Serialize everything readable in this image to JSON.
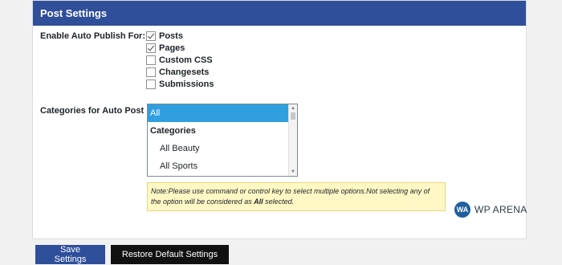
{
  "panel": {
    "title": "Post Settings"
  },
  "auto_publish": {
    "label": "Enable Auto Publish For:",
    "options": [
      {
        "label": "Posts",
        "checked": true
      },
      {
        "label": "Pages",
        "checked": true
      },
      {
        "label": "Custom CSS",
        "checked": false
      },
      {
        "label": "Changesets",
        "checked": false
      },
      {
        "label": "Submissions",
        "checked": false
      }
    ]
  },
  "categories": {
    "label": "Categories for Auto Post",
    "options": [
      {
        "label": "All",
        "kind": "selected"
      },
      {
        "label": "Categories",
        "kind": "group"
      },
      {
        "label": "All Beauty",
        "kind": "child"
      },
      {
        "label": "All Sports",
        "kind": "child"
      }
    ]
  },
  "note": {
    "text_before": "Note:Please use command or control key to select multiple options.Not selecting any of the option will be considered as ",
    "bold": "All",
    "text_after": " selected."
  },
  "watermark": {
    "initials": "WA",
    "text": "WP ARENA"
  },
  "buttons": {
    "save": "Save Settings",
    "restore": "Restore Default Settings"
  },
  "colors": {
    "header": "#2f4f9a",
    "selected": "#2f9fe0",
    "note_bg": "#fff8c5",
    "restore_btn": "#111111"
  }
}
